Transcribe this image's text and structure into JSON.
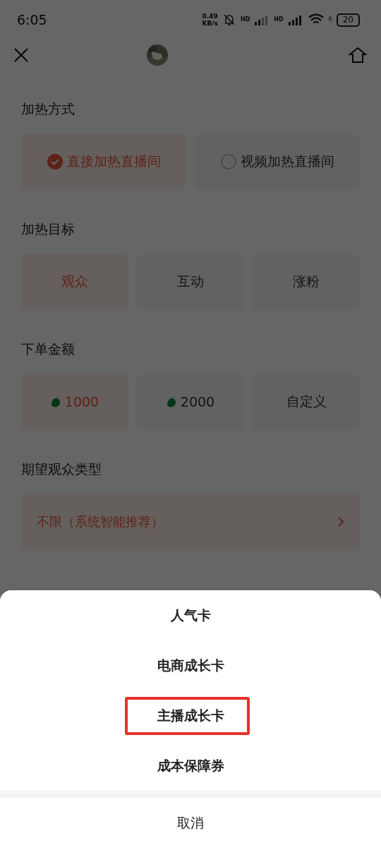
{
  "status_bar": {
    "time": "6:05",
    "net_speed": "0.49",
    "net_unit": "KB/s",
    "sim1_label": "HD",
    "sim2_label": "HD",
    "wifi_label": "6",
    "battery": "20"
  },
  "sections": [
    {
      "title": "加热方式",
      "kind": "radio",
      "options": [
        {
          "label": "直接加热直播间",
          "selected": true
        },
        {
          "label": "视频加热直播间",
          "selected": false
        }
      ]
    },
    {
      "title": "加热目标",
      "kind": "choice",
      "options": [
        {
          "label": "观众",
          "selected": true
        },
        {
          "label": "互动",
          "selected": false
        },
        {
          "label": "涨粉",
          "selected": false
        }
      ]
    },
    {
      "title": "下单金额",
      "kind": "amount",
      "options": [
        {
          "label": "1000",
          "selected": true,
          "coin": true
        },
        {
          "label": "2000",
          "selected": false,
          "coin": true
        },
        {
          "label": "自定义",
          "selected": false,
          "coin": false
        }
      ]
    },
    {
      "title": "期望观众类型",
      "kind": "link",
      "value": "不限（系统智能推荐）"
    }
  ],
  "action_sheet": {
    "items": [
      {
        "label": "人气卡",
        "highlighted": false
      },
      {
        "label": "电商成长卡",
        "highlighted": false
      },
      {
        "label": "主播成长卡",
        "highlighted": true
      },
      {
        "label": "成本保障券",
        "highlighted": false
      }
    ],
    "cancel": "取消"
  }
}
